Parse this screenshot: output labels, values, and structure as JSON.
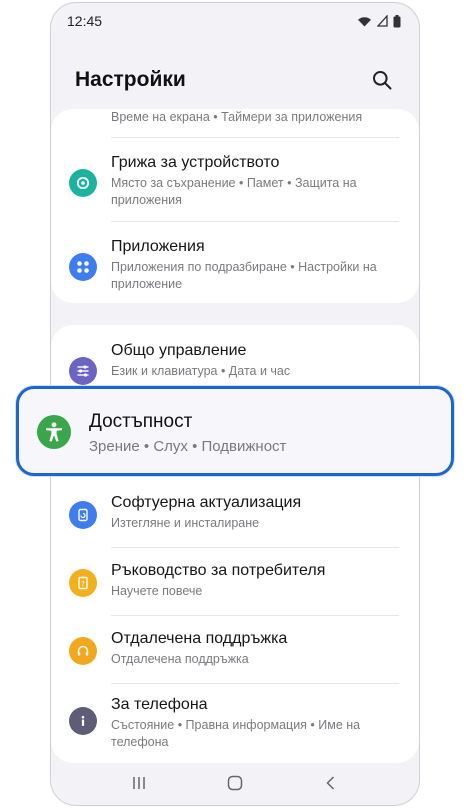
{
  "status": {
    "time": "12:45"
  },
  "header": {
    "title": "Настройки"
  },
  "card1": {
    "partial_sub": "Време на екрана • Таймери за приложения",
    "items": [
      {
        "label": "Грижа за устройството",
        "sub": "Място за съхранение • Памет • Защита на приложения",
        "color": "#1bb3a0"
      },
      {
        "label": "Приложения",
        "sub": "Приложения по подразбиране • Настройки на приложение",
        "color": "#3e7cf0"
      }
    ]
  },
  "card2": {
    "items": [
      {
        "label": "Общо управление",
        "sub": "Език и клавиатура • Дата и час",
        "color": "#6b64c2"
      },
      {
        "label": "Софтуерна актуализация",
        "sub": "Изтегляне и инсталиране",
        "color": "#3e7cf0"
      },
      {
        "label": "Ръководство за потребителя",
        "sub": "Научете повече",
        "color": "#f2b01e"
      },
      {
        "label": "Отдалечена поддръжка",
        "sub": "Отдалечена поддръжка",
        "color": "#f2a81e"
      },
      {
        "label": "За телефона",
        "sub": "Състояние • Правна информация • Име на телефона",
        "color": "#5f5c78"
      }
    ]
  },
  "highlight": {
    "label": "Достъпност",
    "sub": "Зрение • Слух • Подвижност",
    "color": "#3aa54a",
    "border": "#1b66d2"
  }
}
